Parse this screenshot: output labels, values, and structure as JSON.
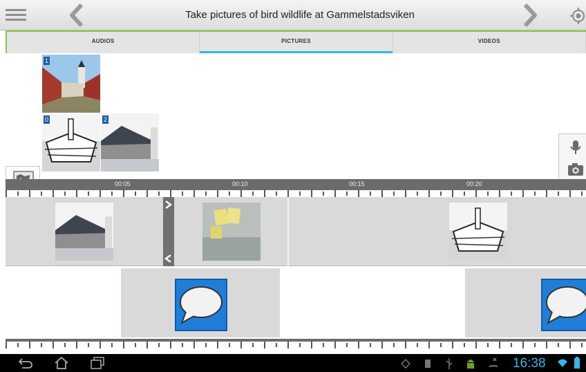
{
  "header": {
    "title": "Take pictures of bird wildlife at Gammelstadsviken"
  },
  "tabs": [
    {
      "label": "AUDIOS",
      "active": false
    },
    {
      "label": "PICTURES",
      "active": true
    },
    {
      "label": "VIDEOS",
      "active": false
    }
  ],
  "pictures": [
    {
      "index": "1",
      "subject": "village street with church"
    },
    {
      "index": "0",
      "subject": "engraving of church and fortifications"
    },
    {
      "index": "2",
      "subject": "stone church in snow"
    }
  ],
  "timeline": {
    "ticks": [
      "00:05",
      "00:10",
      "00:15",
      "00:20"
    ],
    "clips": [
      {
        "subject": "stone church in snow"
      },
      {
        "subject": "sticky notes on wall"
      },
      {
        "subject": "engraving of church and fortifications"
      }
    ]
  },
  "right_tools": [
    {
      "name": "microphone-icon"
    },
    {
      "name": "camera-icon"
    },
    {
      "name": "video-camera-icon"
    },
    {
      "name": "presentation-icon"
    },
    {
      "name": "send-icon"
    }
  ],
  "left_tools": [
    {
      "name": "map-icon"
    },
    {
      "name": "folder-icon"
    }
  ],
  "system": {
    "time": "16:38"
  },
  "colors": {
    "accent": "#33b5e5",
    "tab_border": "#8bc34a",
    "badge": "#1c5fa8",
    "bubble": "#1f7fd8"
  }
}
